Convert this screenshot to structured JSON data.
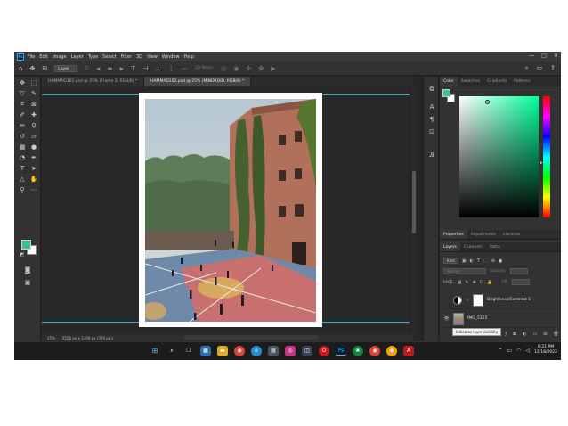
{
  "menu": {
    "items": [
      "File",
      "Edit",
      "Image",
      "Layer",
      "Type",
      "Select",
      "Filter",
      "3D",
      "View",
      "Window",
      "Help"
    ],
    "window_controls": [
      "—",
      "□",
      "✕"
    ]
  },
  "options": {
    "auto_select": "Layer",
    "three_d_mode": "3D Mode:"
  },
  "tabs": [
    {
      "label": "HAMMAD102.psd @ 25% (Frame 2, RGB/8) *",
      "active": false
    },
    {
      "label": "HAMMAD102.psd @ 25% (MINDROID, RGB/8) *",
      "active": true
    }
  ],
  "status": {
    "zoom": "25%",
    "doc_size": "2550 px x 3300 px (300 ppi)"
  },
  "color_panel": {
    "tabs": [
      "Color",
      "Swatches",
      "Gradients",
      "Patterns"
    ],
    "foreground": "#3dbf9a",
    "background": "#ffffff"
  },
  "properties_panel": {
    "tabs": [
      "Properties",
      "Adjustments",
      "Libraries"
    ]
  },
  "layers_panel": {
    "tabs": [
      "Layers",
      "Channels",
      "Paths"
    ],
    "filter_kind": "Kind",
    "blend_mode": "Normal",
    "opacity_label": "Opacity:",
    "lock_label": "Lock:",
    "fill_label": "Fill:",
    "layers": [
      {
        "name": "Brightness/Contrast 1",
        "type": "adjustment"
      },
      {
        "name": "IMG_5325",
        "type": "image"
      }
    ],
    "tooltip": "Indicates layer visibility"
  },
  "taskbar": {
    "time": "6:21 PM",
    "date": "12/18/2022"
  }
}
